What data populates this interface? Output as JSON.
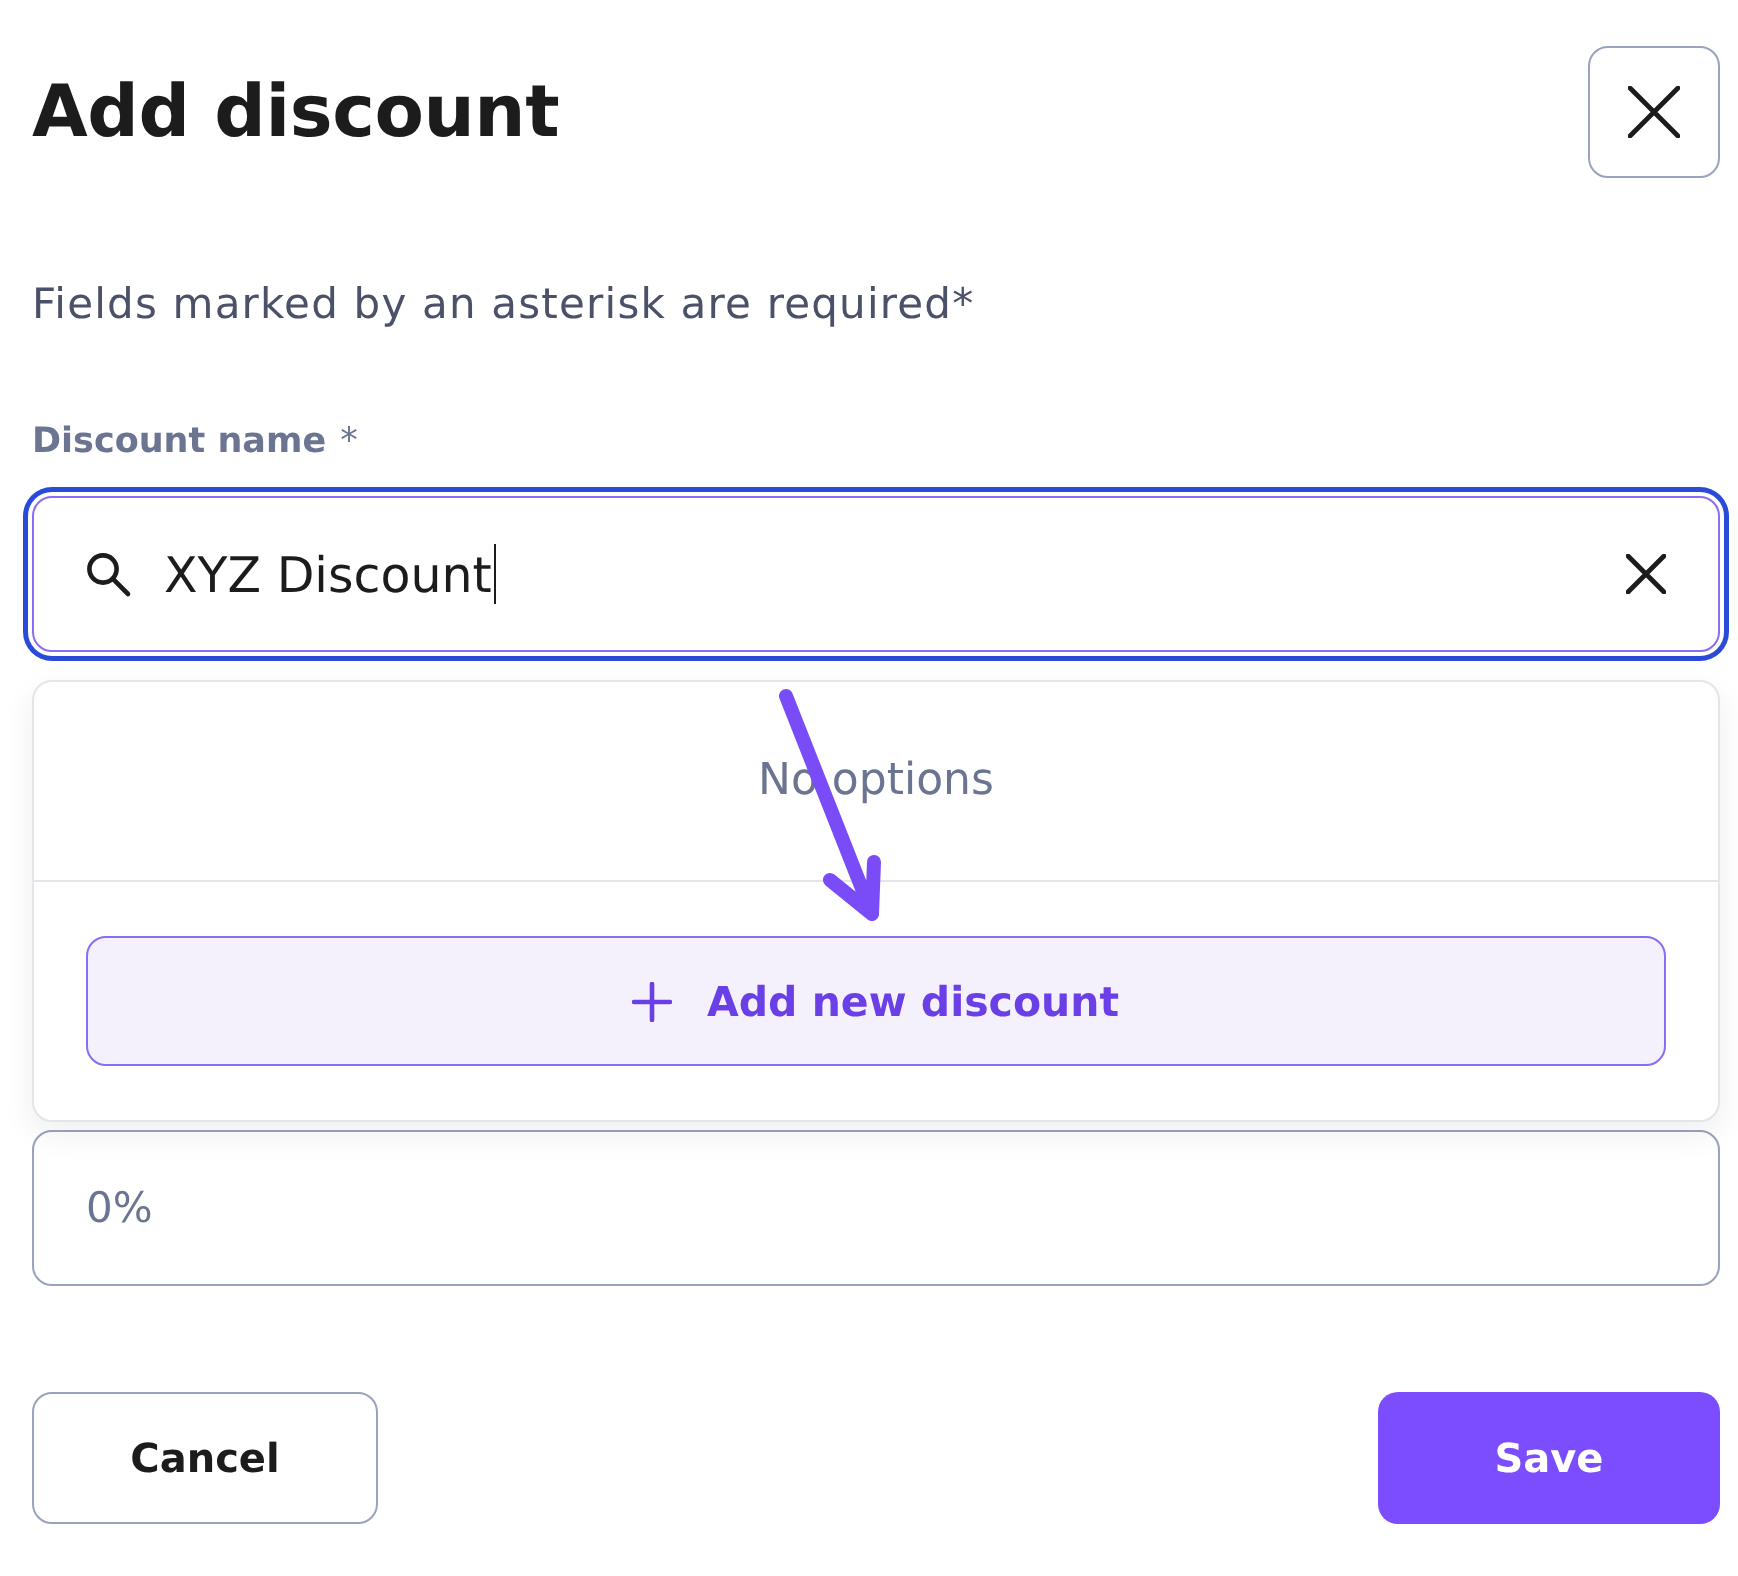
{
  "dialog": {
    "title": "Add discount",
    "note": "Fields marked by an asterisk are required*"
  },
  "discount_name": {
    "label": "Discount name",
    "required_mark": "*",
    "value": "XYZ Discount",
    "focused": true
  },
  "dropdown": {
    "empty_text": "No options",
    "add_button": "Add new discount"
  },
  "discount_field": {
    "placeholder": "0%"
  },
  "buttons": [
    {
      "label": "Cancel",
      "kind": "secondary"
    },
    {
      "label": "Save",
      "kind": "primary"
    }
  ]
}
